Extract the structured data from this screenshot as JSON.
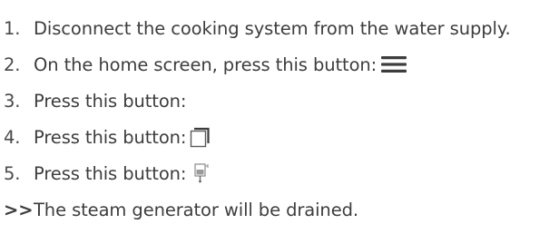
{
  "steps": [
    {
      "number": "1.",
      "text": "Disconnect the cooking system from the water supply.",
      "icon": ""
    },
    {
      "number": "2.",
      "text": "On the home screen, press this button:",
      "icon": "hamburger-menu-icon"
    },
    {
      "number": "3.",
      "text": "Press this button:",
      "icon": ""
    },
    {
      "number": "4.",
      "text": "Press this button:",
      "icon": "stacked-windows-icon"
    },
    {
      "number": "5.",
      "text": "Press this button:",
      "icon": "steam-generator-drain-icon"
    }
  ],
  "result": {
    "marker": ">>",
    "text": "The steam generator will be drained."
  },
  "colors": {
    "text": "#3d3d3d",
    "icon": "#3d3d3d",
    "icon_light": "#8a8a8a"
  }
}
